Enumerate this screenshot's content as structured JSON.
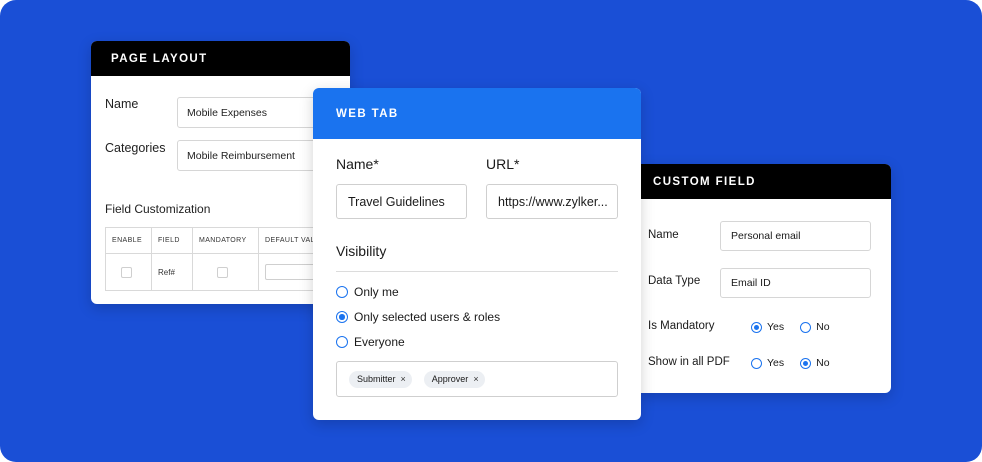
{
  "page_layout": {
    "title": "PAGE LAYOUT",
    "name_label": "Name",
    "name_value": "Mobile Expenses",
    "categories_label": "Categories",
    "categories_value": "Mobile Reimbursement",
    "section_title": "Field Customization",
    "table": {
      "headers": [
        "ENABLE",
        "FIELD",
        "MANDATORY",
        "DEFAULT VAL"
      ],
      "row": {
        "field": "Ref#"
      }
    }
  },
  "web_tab": {
    "title": "WEB TAB",
    "name_label": "Name*",
    "name_value": "Travel Guidelines",
    "url_label": "URL*",
    "url_value": "https://www.zylker...",
    "visibility_label": "Visibility",
    "options": [
      {
        "label": "Only me",
        "selected": false
      },
      {
        "label": "Only selected users & roles",
        "selected": true
      },
      {
        "label": "Everyone",
        "selected": false
      }
    ],
    "chips": [
      "Submitter",
      "Approver"
    ],
    "chip_remove_glyph": "×"
  },
  "custom_field": {
    "title": "CUSTOM FIELD",
    "name_label": "Name",
    "name_value": "Personal email",
    "data_type_label": "Data Type",
    "data_type_value": "Email ID",
    "mandatory_label": "Is Mandatory",
    "mandatory_yes": "Yes",
    "mandatory_no": "No",
    "mandatory_selected": "Yes",
    "pdf_label": "Show in all PDF",
    "pdf_yes": "Yes",
    "pdf_no": "No",
    "pdf_selected": "No"
  },
  "colors": {
    "background": "#1a4fd6",
    "accent": "#1a73ef",
    "header_dark": "#000000"
  }
}
